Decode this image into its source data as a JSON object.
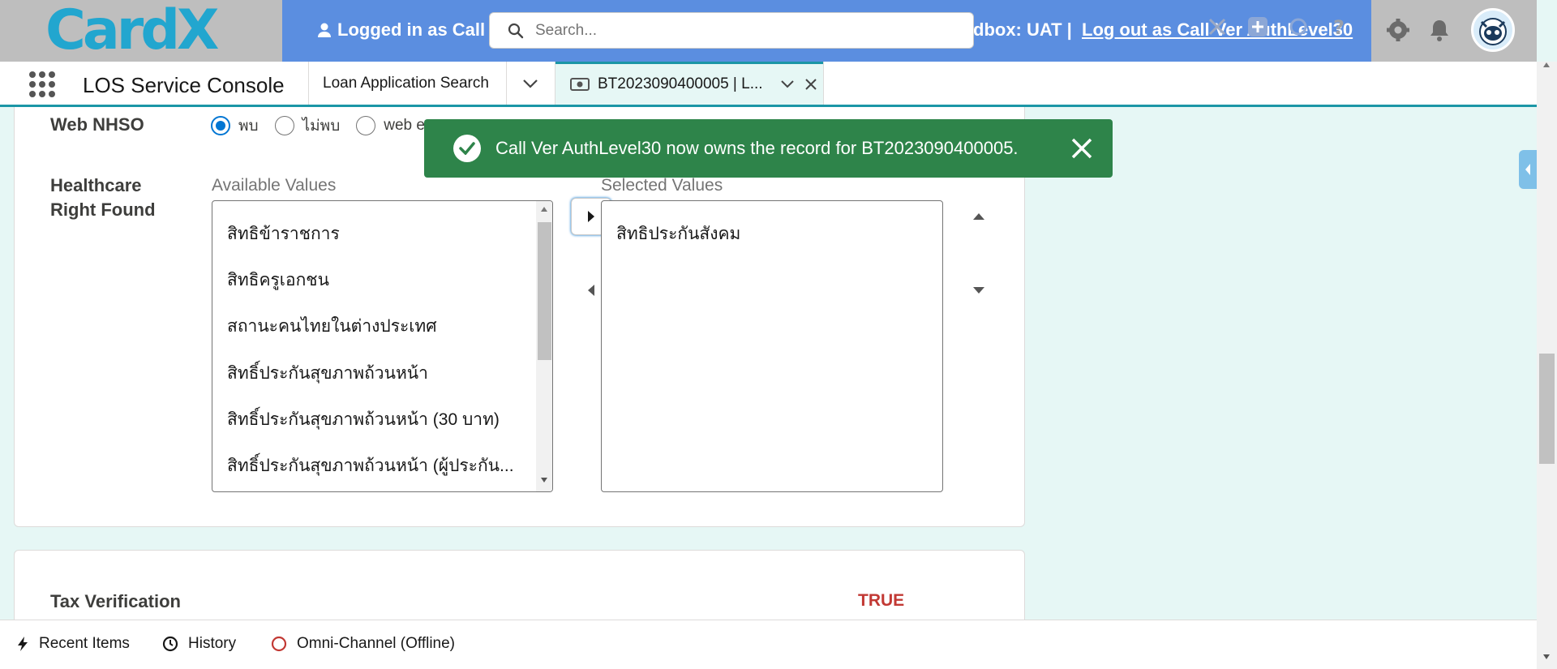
{
  "header": {
    "logo_text": "CardX",
    "logged_in_text": "Logged in as Call",
    "sandbox_text": "dbox: UAT |",
    "logout_text": "Log out as Call Ver AuthLevel30",
    "search_placeholder": "Search..."
  },
  "nav": {
    "app_name": "LOS Service Console",
    "tab_search_label": "Loan Application Search",
    "tab_active_label": "BT2023090400005 | L..."
  },
  "form": {
    "web_nhso_label": "Web NHSO",
    "web_nhso_options": [
      "พบ",
      "ไม่พบ",
      "web er"
    ],
    "web_nhso_selected": "พบ",
    "healthcare_label_line1": "Healthcare",
    "healthcare_label_line2": "Right Found",
    "available_header": "Available Values",
    "selected_header": "Selected Values",
    "available_values": [
      "สิทธิข้าราชการ",
      "สิทธิครูเอกชน",
      "สถานะคนไทยในต่างประเทศ",
      "สิทธิ์ประกันสุขภาพถ้วนหน้า",
      "สิทธิ์ประกันสุขภาพถ้วนหน้า (30 บาท)",
      "สิทธิ์ประกันสุขภาพถ้วนหน้า (ผู้ประกัน..."
    ],
    "selected_values": [
      "สิทธิประกันสังคม"
    ],
    "tax_label": "Tax Verification",
    "tax_value": "TRUE"
  },
  "toast": {
    "message": "Call Ver AuthLevel30 now owns the record for BT2023090400005."
  },
  "utility": {
    "recent_items": "Recent Items",
    "history": "History",
    "omni_channel": "Omni-Channel (Offline)"
  },
  "colors": {
    "header_blue": "#5b8ee0",
    "toast_green": "#2e844a",
    "accent_teal": "#1b96a6",
    "true_red": "#c23934",
    "page_bg": "#e6f7f5"
  }
}
